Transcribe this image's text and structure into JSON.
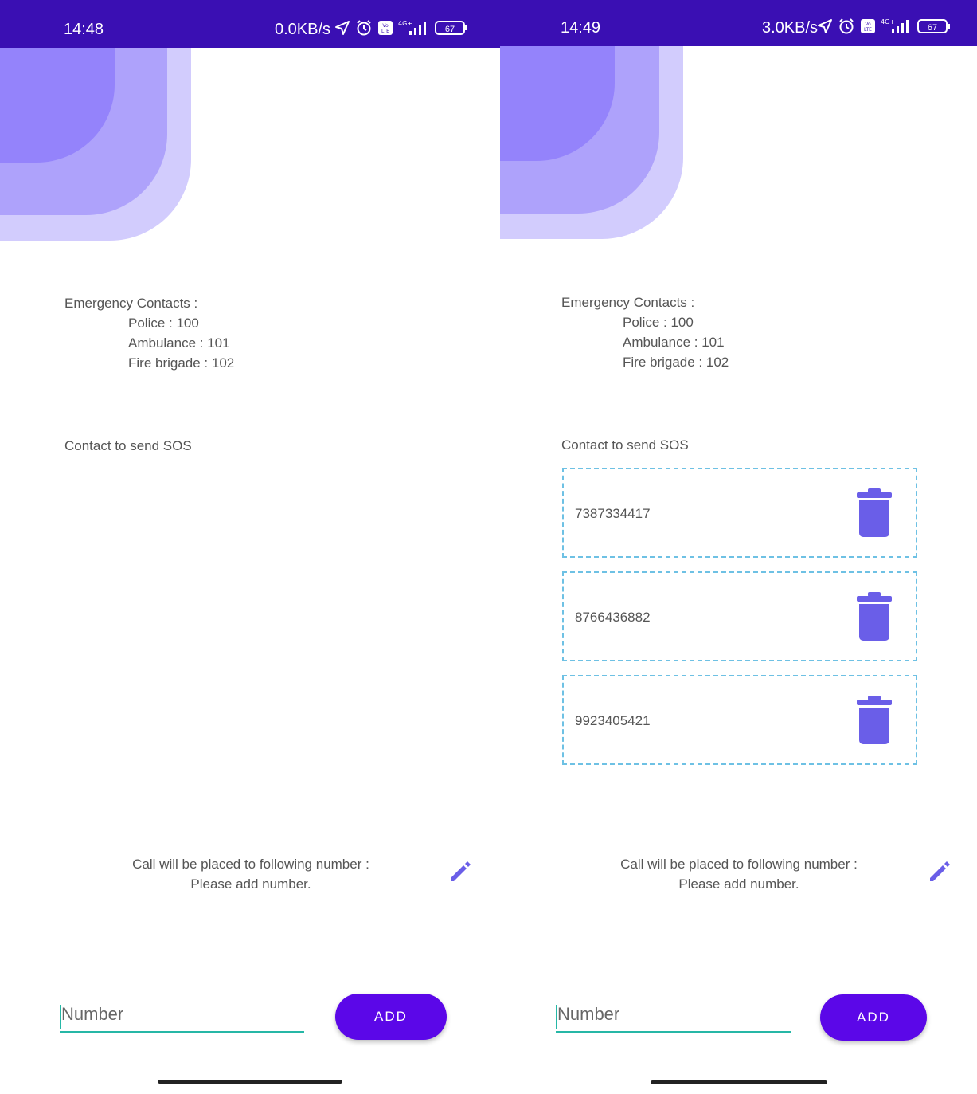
{
  "left": {
    "status": {
      "time": "14:48",
      "speed": "0.0KB/s",
      "battery": "67",
      "network": "4G+"
    },
    "emergency": {
      "title": "Emergency Contacts :",
      "police": "Police : 100",
      "ambulance": "Ambulance : 101",
      "fire": "Fire brigade : 102"
    },
    "sos_label": "Contact to send SOS",
    "call": {
      "line1": "Call will be placed to following number :",
      "line2": "Please add number."
    },
    "input": {
      "placeholder": "Number"
    },
    "add_label": "ADD"
  },
  "right": {
    "status": {
      "time": "14:49",
      "speed": "3.0KB/s",
      "battery": "67",
      "network": "4G+"
    },
    "emergency": {
      "title": "Emergency Contacts :",
      "police": "Police : 100",
      "ambulance": "Ambulance : 101",
      "fire": "Fire brigade : 102"
    },
    "sos_label": "Contact to send SOS",
    "sos_contacts": [
      "7387334417",
      "8766436882",
      "9923405421"
    ],
    "call": {
      "line1": "Call will be placed to following number :",
      "line2": "Please add number."
    },
    "input": {
      "placeholder": "Number"
    },
    "add_label": "ADD"
  },
  "colors": {
    "status_bar": "#3a0fb3",
    "accent_button": "#5b07e8",
    "trash_icon": "#6a5ee8",
    "input_underline": "#26b7a6",
    "dashed_border": "#6ec1e4",
    "blob_dark": "#9483fb",
    "blob_mid": "#aea2fb",
    "blob_light": "#d2ccfd"
  }
}
